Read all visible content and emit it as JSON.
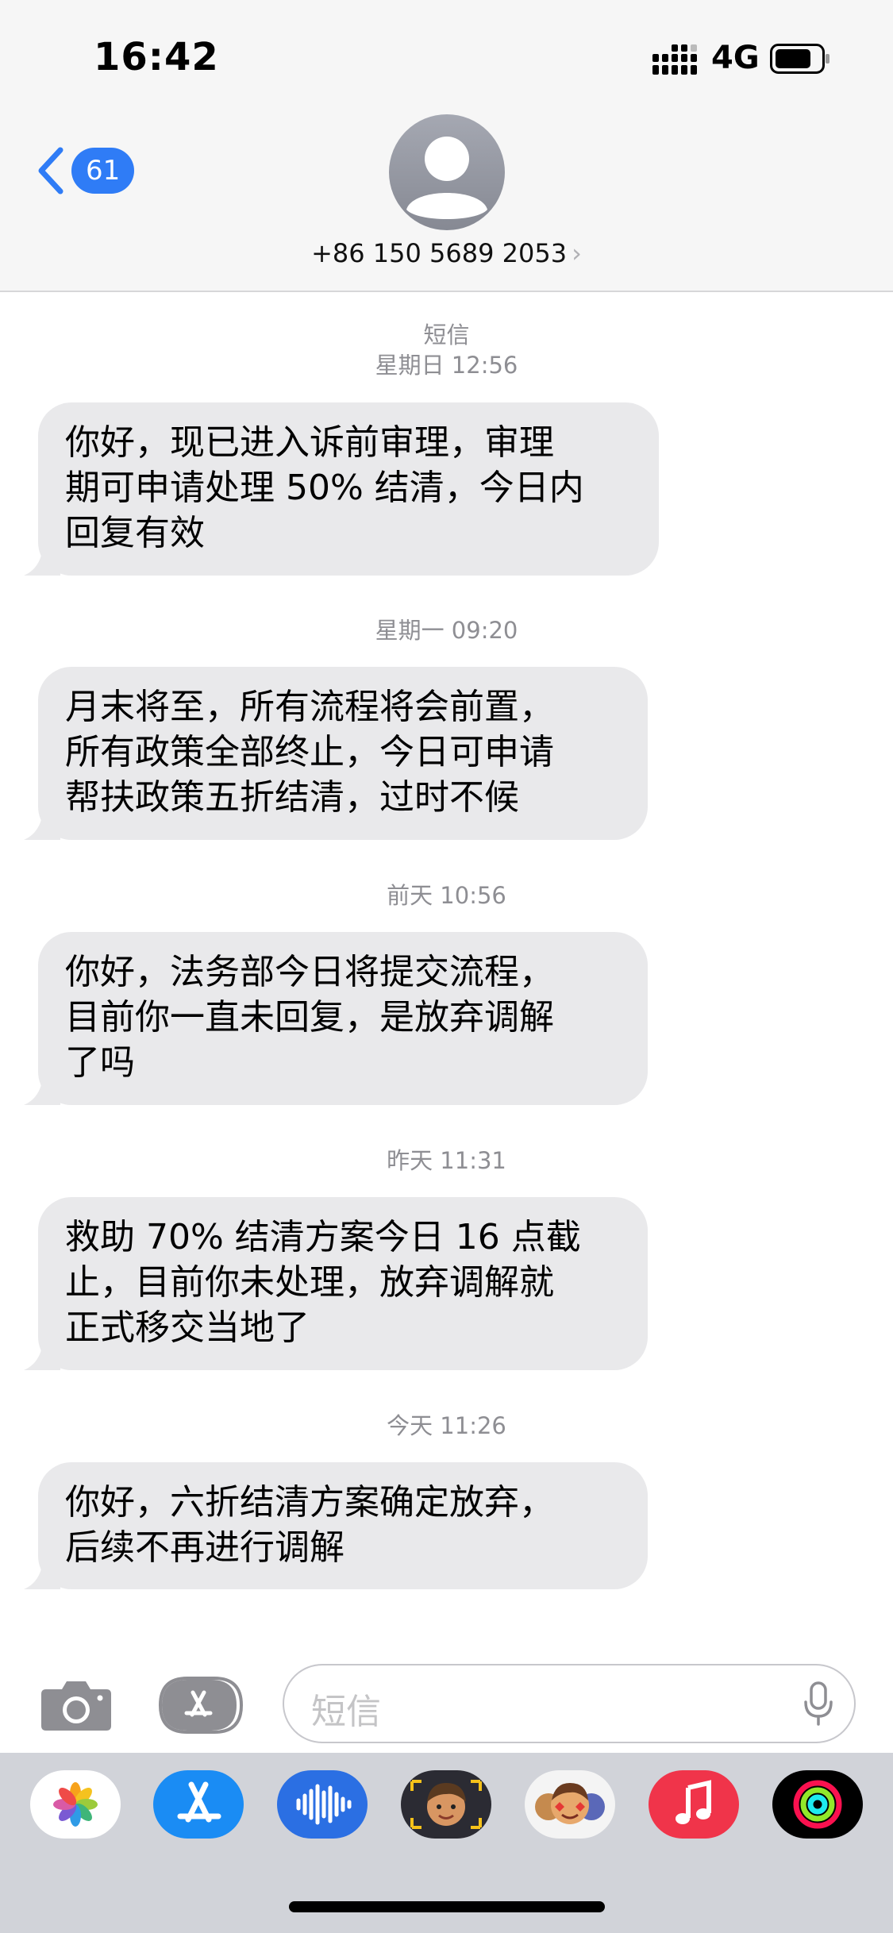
{
  "status_bar": {
    "time": "16:42",
    "network": "4G"
  },
  "header": {
    "back_badge": "61",
    "contact": "+86 150 5689 2053",
    "chevron": "›"
  },
  "conversation": [
    {
      "ts": "短信",
      "ts2": "星期日 12:56",
      "lines": [
        "你好，现已进入诉前审理，审理",
        "期可申请处理 50% 结清，今日内",
        "回复有效"
      ]
    },
    {
      "ts": "星期一 09:20",
      "lines": [
        "月末将至，所有流程将会前置，",
        "所有政策全部终止，今日可申请",
        "帮扶政策五折结清，过时不候"
      ]
    },
    {
      "ts": "前天 10:56",
      "lines": [
        "你好，法务部今日将提交流程，",
        "目前你一直未回复，是放弃调解",
        "了吗"
      ]
    },
    {
      "ts": "昨天 11:31",
      "lines": [
        "救助 70% 结清方案今日 16 点截",
        "止，目前你未处理，放弃调解就",
        "正式移交当地了"
      ]
    },
    {
      "ts": "今天 11:26",
      "lines": [
        "你好，六折结清方案确定放弃，",
        "后续不再进行调解"
      ]
    }
  ],
  "input": {
    "placeholder": "短信"
  },
  "app_drawer": {
    "apps": [
      "photos-icon",
      "app-store-icon",
      "audio-messages-icon",
      "memoji-icon",
      "animoji-icon",
      "music-icon",
      "activity-icon"
    ]
  },
  "colors": {
    "bubble": "#e9e9eb",
    "accent": "#2f7cf6",
    "timestamp": "#8e8e93",
    "drawer": "#d1d3d9"
  }
}
